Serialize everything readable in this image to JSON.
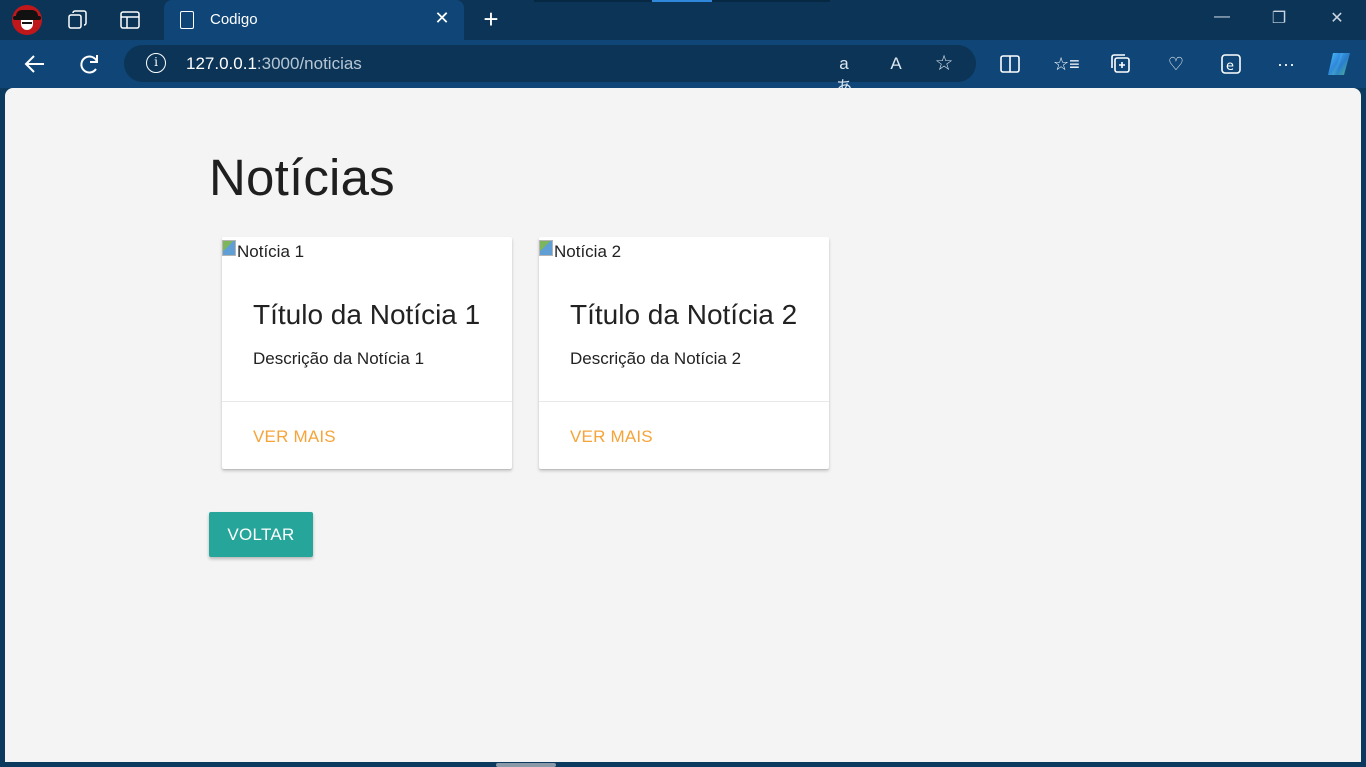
{
  "browser": {
    "tab_title": "Codigo",
    "url_host": "127.0.0.1",
    "url_rest": ":3000/noticias",
    "icons": [
      "profile-avatar-icon",
      "workspaces-icon",
      "tab-actions-icon",
      "document-icon",
      "close-icon",
      "plus-icon",
      "minimize-icon",
      "restore-icon",
      "close-window-icon",
      "back-arrow-icon",
      "refresh-icon",
      "info-icon",
      "translate-icon",
      "read-aloud-icon",
      "favorite-star-icon",
      "split-screen-icon",
      "favorites-icon",
      "collections-icon",
      "browser-essentials-icon",
      "edge-icon",
      "more-icon",
      "copilot-icon"
    ]
  },
  "page": {
    "title": "Notícias",
    "back_button": "VOLTAR",
    "cards": [
      {
        "image_alt": "Notícia 1",
        "title": "Título da Notícia 1",
        "description": "Descrição da Notícia 1",
        "action": "VER MAIS"
      },
      {
        "image_alt": "Notícia 2",
        "title": "Título da Notícia 2",
        "description": "Descrição da Notícia 2",
        "action": "VER MAIS"
      }
    ]
  },
  "colors": {
    "accent_orange": "#f5a43a",
    "button_teal": "#26a69a",
    "chrome_blue": "#0f4677"
  }
}
